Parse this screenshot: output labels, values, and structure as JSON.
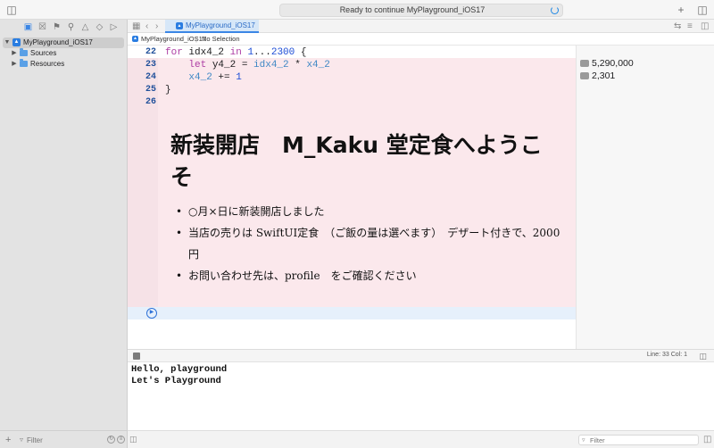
{
  "titlebar": {
    "activity_text": "Ready to continue MyPlayground_iOS17"
  },
  "sidebar": {
    "items": [
      {
        "label": "MyPlayground_iOS17",
        "selected": true
      },
      {
        "label": "Sources"
      },
      {
        "label": "Resources"
      }
    ],
    "filter_placeholder": "Filter"
  },
  "tabs": [
    {
      "label": "MyPlayground_iOS17",
      "active": true
    }
  ],
  "jumpbar": {
    "file": "MyPlayground_iOS17",
    "separator": "|",
    "selection": "No Selection"
  },
  "editor": {
    "line_numbers": [
      "22",
      "23",
      "24",
      "25",
      "26"
    ],
    "code": [
      "for idx4_2 in 1...2300 {",
      "    let y4_2 = idx4_2 * x4_2",
      "    x4_2 += 1",
      "}",
      ""
    ]
  },
  "preview": {
    "title": "新装開店　M_Kaku 堂定食へようこそ",
    "items": [
      "○月×日に新装開店しました",
      "当店の売りは SwiftUI定食　（ご飯の量は選べます）　デザート付きで、2000円",
      "お問い合わせ先は、profile　をご確認ください"
    ]
  },
  "results": [
    "5,290,000",
    "2,301"
  ],
  "debug": {
    "cursor": "Line: 33  Col: 1"
  },
  "console": {
    "lines": [
      "Hello, playground",
      "Let's Playground"
    ],
    "filter_placeholder": "Filter"
  },
  "colors": {
    "accent": "#3b86e5",
    "preview_background": "#fbe8ec",
    "keyword": "#ad3da4",
    "number": "#1c4cd6"
  }
}
